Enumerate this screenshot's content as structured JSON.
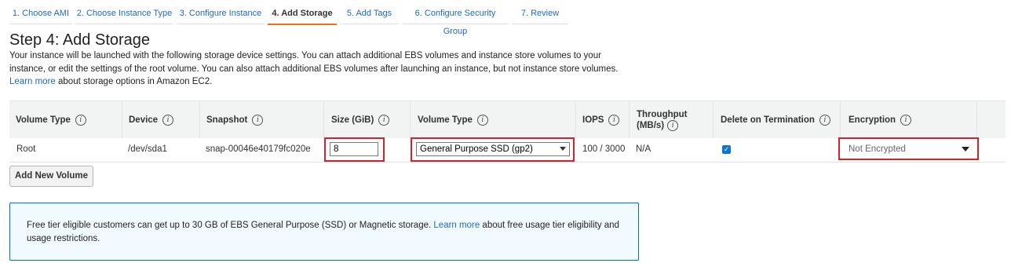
{
  "steps": [
    {
      "label": "1. Choose AMI"
    },
    {
      "label": "2. Choose Instance Type"
    },
    {
      "label": "3. Configure Instance"
    },
    {
      "label": "4. Add Storage",
      "active": true
    },
    {
      "label": "5. Add Tags"
    },
    {
      "label": "6. Configure Security Group"
    },
    {
      "label": "7. Review"
    }
  ],
  "page": {
    "title": "Step 4: Add Storage",
    "description_part1": "Your instance will be launched with the following storage device settings. You can attach additional EBS volumes and instance store volumes to your instance, or edit the settings of the root volume. You can also attach additional EBS volumes after launching an instance, but not instance store volumes.",
    "learn_more": "Learn more",
    "description_part2": "about storage options in Amazon EC2."
  },
  "table": {
    "headers": {
      "volume_type": "Volume Type",
      "device": "Device",
      "snapshot": "Snapshot",
      "size": "Size (GiB)",
      "volume_type2": "Volume Type",
      "iops": "IOPS",
      "throughput_line1": "Throughput",
      "throughput_line2": "(MB/s)",
      "delete_on_termination": "Delete on Termination",
      "encryption": "Encryption"
    },
    "info_icon": "i",
    "row": {
      "volume_type": "Root",
      "device": "/dev/sda1",
      "snapshot": "snap-00046e40179fc020e",
      "size": "8",
      "volume_type_selected": "General Purpose SSD (gp2)",
      "iops": "100 / 3000",
      "throughput": "N/A",
      "delete_on_termination": true,
      "delete_check_mark": "✓",
      "encryption": "Not Encrypted"
    }
  },
  "add_volume_button": "Add New Volume",
  "notice": {
    "text_part1": "Free tier eligible customers can get up to 30 GB of EBS General Purpose (SSD) or Magnetic storage.",
    "learn_more": "Learn more",
    "text_part2": "about free usage tier eligibility and usage restrictions."
  },
  "colors": {
    "accent_tab": "#ec7211",
    "link": "#1f6ac0",
    "highlight_box": "#d0232b",
    "notice_border": "#0073bb",
    "notice_bg": "#f1faff",
    "checkbox": "#0b74d6"
  },
  "icons": [
    "info-icon",
    "chevron-down-icon",
    "checkbox-checked-icon"
  ]
}
